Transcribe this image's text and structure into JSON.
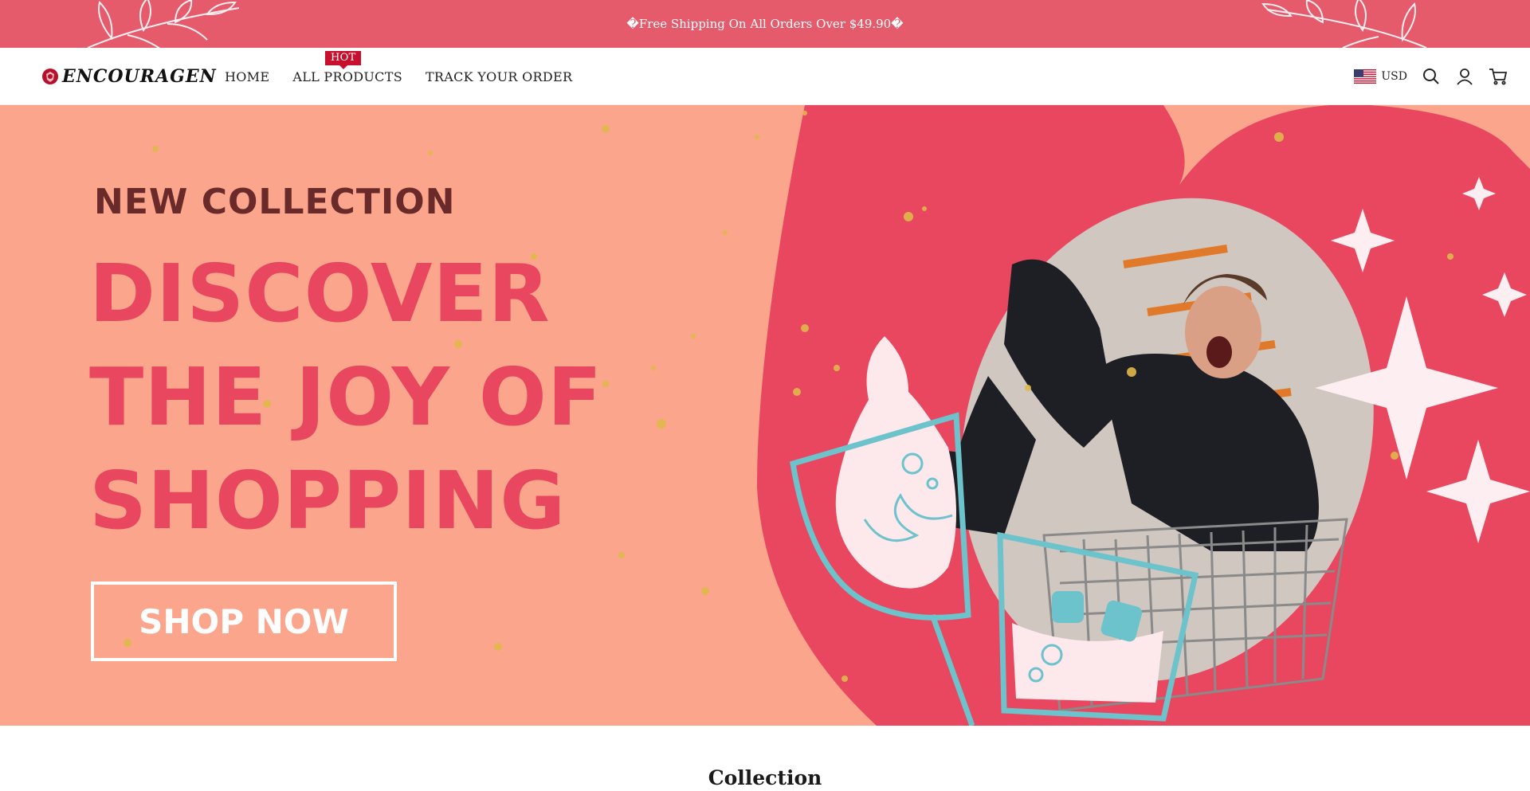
{
  "announcement": {
    "text": "�Free Shipping On All Orders Over $49.90�"
  },
  "header": {
    "logo_text": "ENCOURAGEN",
    "nav": [
      {
        "label": "HOME"
      },
      {
        "label": "ALL PRODUCTS",
        "badge": "HOT"
      },
      {
        "label": "TRACK YOUR ORDER"
      }
    ],
    "currency": "USD",
    "icons": [
      "us-flag-icon",
      "search-icon",
      "account-icon",
      "cart-icon"
    ]
  },
  "hero": {
    "eyebrow": "NEW COLLECTION",
    "title_lines": [
      "DISCOVER",
      "THE JOY OF",
      "SHOPPING"
    ],
    "cta_label": "SHOP NOW"
  },
  "collection": {
    "title": "Collection"
  },
  "colors": {
    "announce_bg": "#e55b6b",
    "hero_bg": "#fba58c",
    "hero_accent": "#e8475f",
    "eyebrow": "#6b2a2a",
    "badge": "#c8102e"
  }
}
